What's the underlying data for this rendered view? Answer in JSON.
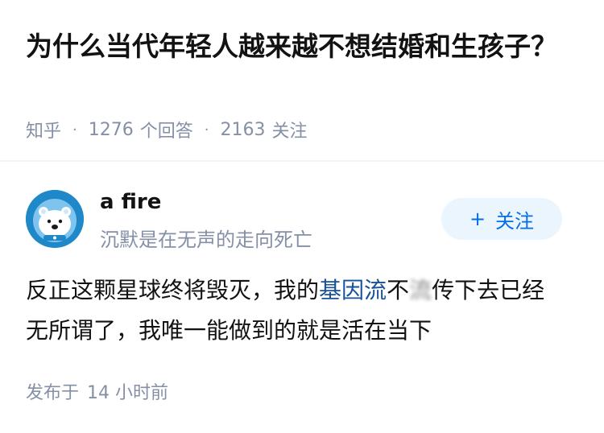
{
  "question": {
    "title": "为什么当代年轻人越来越不想结婚和生孩子？",
    "source": "知乎",
    "answer_count": "1276",
    "answer_label": "个回答",
    "follower_count": "2163",
    "follower_label": "关注"
  },
  "author": {
    "name": "a fire",
    "bio": "沉默是在无声的走向死亡",
    "avatar_icon": "polar-bear-avatar-icon",
    "follow_plus": "+",
    "follow_label": "关注"
  },
  "answer": {
    "part1": "反正这颗星球终将毁灭，我的",
    "link_text": "基因流",
    "part2": "不",
    "blurred": "流",
    "part3": "传下去已经无所谓了，我唯一能做到的就是活在当下"
  },
  "publish": {
    "label": "发布于",
    "time": "14 小时前"
  },
  "colors": {
    "accent": "#056de8",
    "link": "#175199",
    "meta": "#8590a6",
    "follow_bg": "#ebf5fd",
    "avatar_bg": "#1e88c9"
  }
}
